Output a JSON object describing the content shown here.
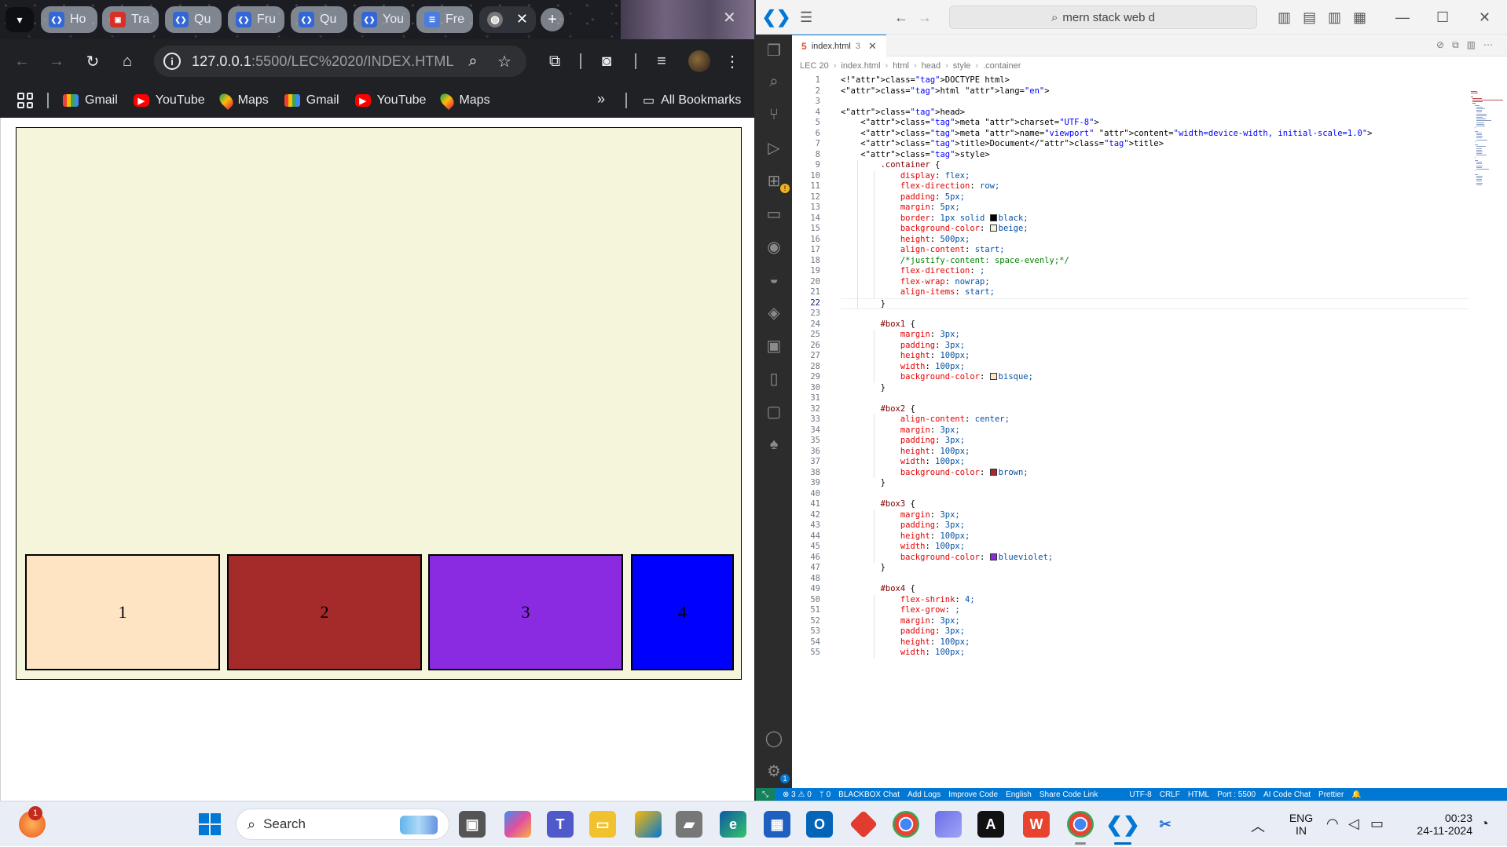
{
  "browser": {
    "tabs": [
      {
        "label": "Ho",
        "icon": "code-icon"
      },
      {
        "label": "Tra",
        "icon": "tv-icon"
      },
      {
        "label": "Qu",
        "icon": "code-icon"
      },
      {
        "label": "Fru",
        "icon": "code-icon"
      },
      {
        "label": "Qu",
        "icon": "code-icon"
      },
      {
        "label": "You",
        "icon": "code-icon"
      },
      {
        "label": "Fre",
        "icon": "forms-icon"
      }
    ],
    "url_host": "127.0.0.1",
    "url_rest": ":5500/LEC%2020/INDEX.HTML",
    "bookmarks": [
      {
        "label": "Gmail",
        "icon": "gmail-icon"
      },
      {
        "label": "YouTube",
        "icon": "youtube-icon"
      },
      {
        "label": "Maps",
        "icon": "maps-icon"
      },
      {
        "label": "Gmail",
        "icon": "gmail-icon"
      },
      {
        "label": "YouTube",
        "icon": "youtube-icon"
      },
      {
        "label": "Maps",
        "icon": "maps-icon"
      }
    ],
    "more_bookmarks": "»",
    "all_bookmarks": "All Bookmarks",
    "page": {
      "boxes": [
        {
          "label": "1",
          "color": "#ffe4c4"
        },
        {
          "label": "2",
          "color": "#a52a2a"
        },
        {
          "label": "3",
          "color": "#8a2be2"
        },
        {
          "label": "4",
          "color": "#0000ff"
        }
      ]
    }
  },
  "vscode": {
    "search_text": "mern stack web d",
    "tab": {
      "filename": "index.html",
      "count": "3"
    },
    "breadcrumb": [
      "LEC 20",
      "index.html",
      "html",
      "head",
      "style",
      ".container"
    ],
    "code": [
      "<!DOCTYPE html>",
      "<html lang=\"en\">",
      "",
      "<head>",
      "    <meta charset=\"UTF-8\">",
      "    <meta name=\"viewport\" content=\"width=device-width, initial-scale=1.0\">",
      "    <title>Document</title>",
      "    <style>",
      "        .container {",
      "            display: flex;",
      "            flex-direction: row;",
      "            padding: 5px;",
      "            margin: 5px;",
      "            border: 1px solid black;",
      "            background-color: beige;",
      "            height: 500px;",
      "            align-content: start;",
      "            /*justify-content: space-evenly;*/",
      "            flex-direction: ;",
      "            flex-wrap: nowrap;",
      "            align-items: start;",
      "        }",
      "",
      "        #box1 {",
      "            margin: 3px;",
      "            padding: 3px;",
      "            height: 100px;",
      "            width: 100px;",
      "            background-color: bisque;",
      "        }",
      "",
      "        #box2 {",
      "            align-content: center;",
      "            margin: 3px;",
      "            padding: 3px;",
      "            height: 100px;",
      "            width: 100px;",
      "            background-color: brown;",
      "        }",
      "",
      "        #box3 {",
      "            margin: 3px;",
      "            padding: 3px;",
      "            height: 100px;",
      "            width: 100px;",
      "            background-color: blueviolet;",
      "        }",
      "",
      "        #box4 {",
      "            flex-shrink: 4;",
      "            flex-grow: ;",
      "            margin: 3px;",
      "            padding: 3px;",
      "            height: 100px;",
      "            width: 100px;"
    ],
    "current_line": 22,
    "status": {
      "errors": "3",
      "warnings": "0",
      "ports": "0",
      "items": [
        "BLACKBOX Chat",
        "Add Logs",
        "Improve Code",
        "English",
        "Share Code Link"
      ],
      "encoding": "UTF-8",
      "eol": "CRLF",
      "language": "HTML",
      "port": "Port : 5500",
      "ai": "AI Code Chat",
      "prettier": "Prettier"
    }
  },
  "taskbar": {
    "search": "Search",
    "notification_count": "1",
    "lang_top": "ENG",
    "lang_bottom": "IN",
    "time": "00:23",
    "date": "24-11-2024"
  }
}
